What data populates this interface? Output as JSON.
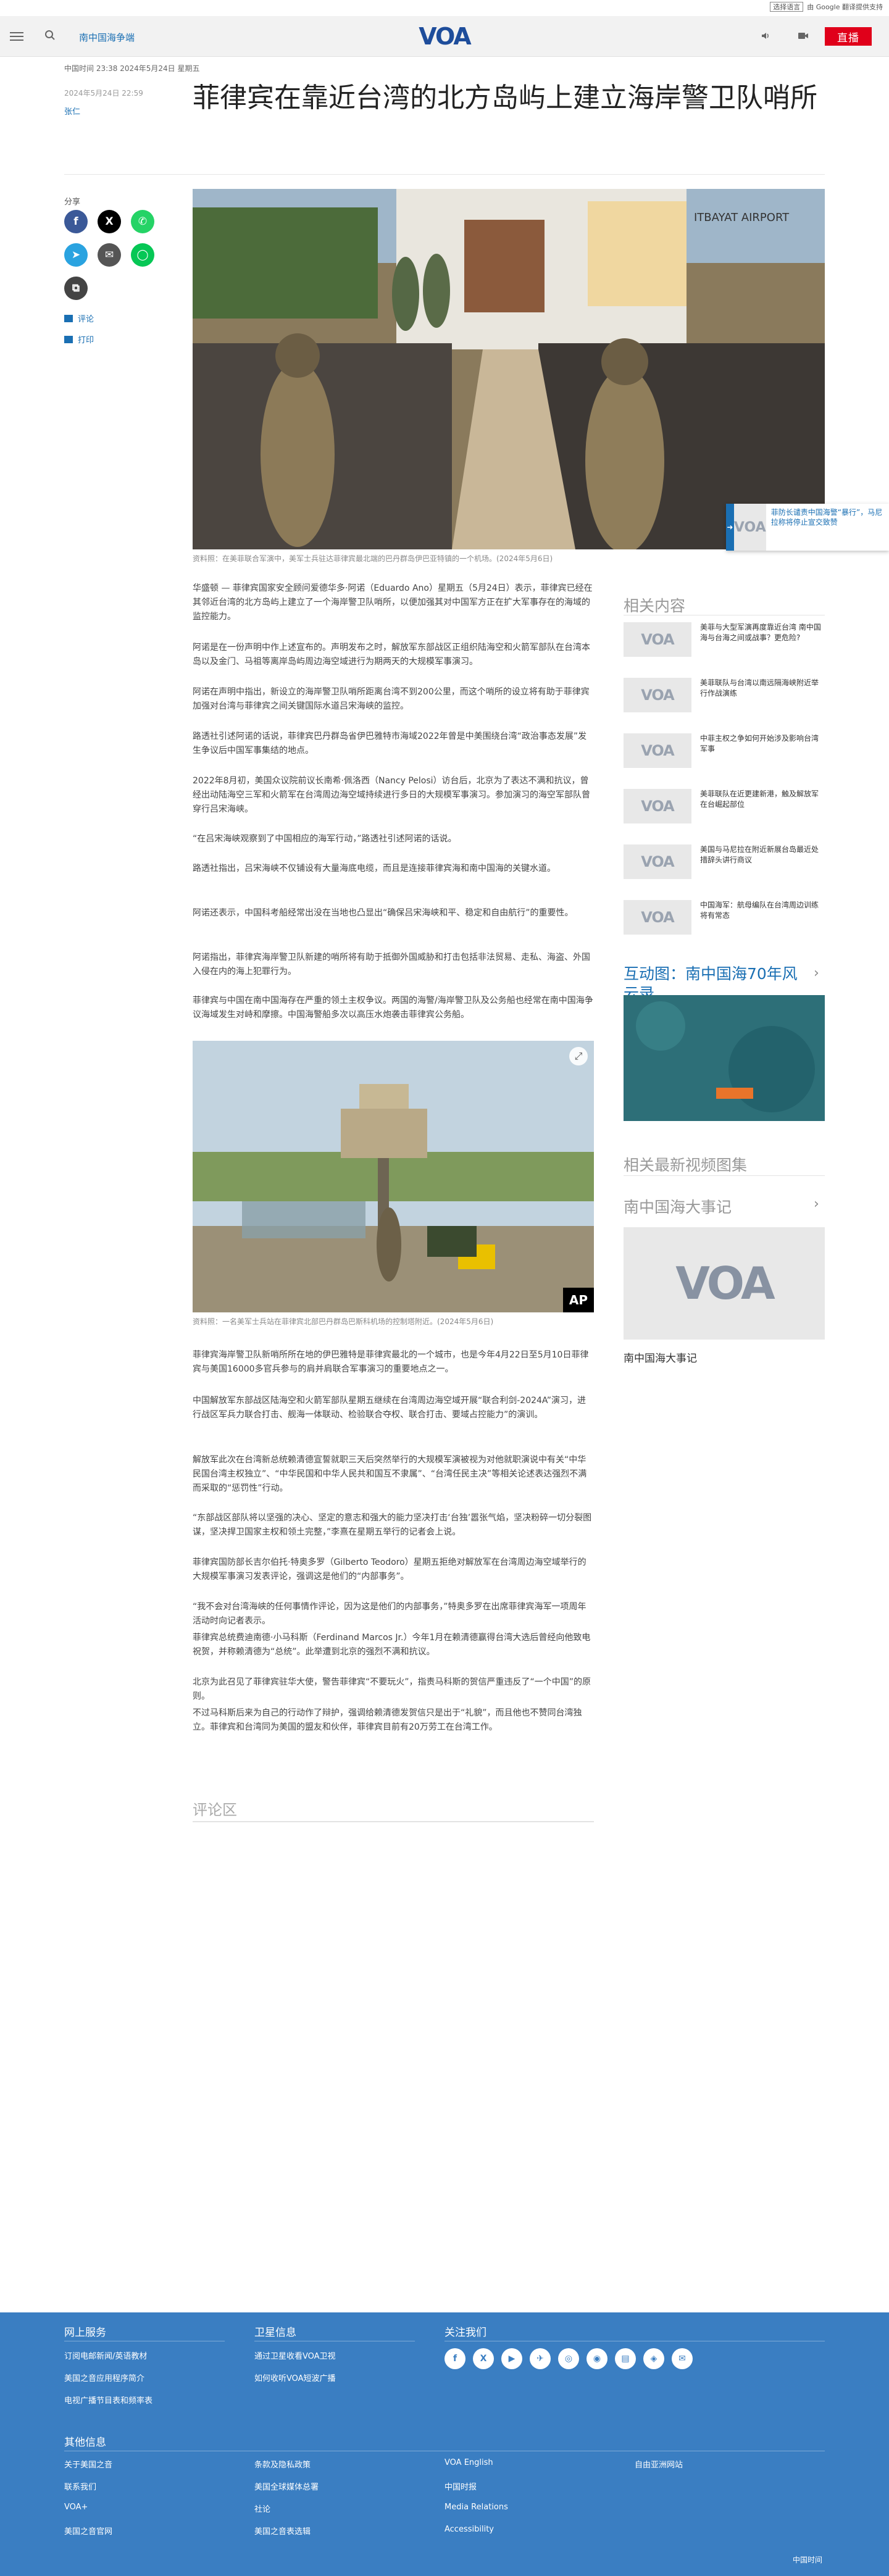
{
  "util": {
    "language_select": "选择语言",
    "powered": "由 Google 翻译提供支持"
  },
  "header": {
    "section_link": "南中国海争端",
    "logo": "VOA",
    "live_label": "直播"
  },
  "meta": {
    "top_line": "中国时间 23:38 2024年5月24日 星期五",
    "date": "2024年5月24日 22:59",
    "author": "张仁"
  },
  "title": "菲律宾在靠近台湾的北方岛屿上建立海岸警卫队哨所",
  "share": {
    "label": "分享",
    "comment_label": "评论",
    "print_label": "打印"
  },
  "hero": {
    "sign_text": "ITBAYAT AIRPORT",
    "caption": "资料照：在美菲联合军演中，美军士兵驻达菲律宾最北端的巴丹群岛伊巴亚特镇的一个机场。(2024年5月6日)"
  },
  "article": {
    "paragraphs": [
      "华盛顿 — 菲律宾国家安全顾问爱德华多·阿诺（Eduardo Ano）星期五（5月24日）表示，菲律宾已经在其邻近台湾的北方岛屿上建立了一个海岸警卫队哨所，以便加强其对中国军方正在扩大军事存在的海域的监控能力。",
      "阿诺是在一份声明中作上述宣布的。声明发布之时，解放军东部战区正组织陆海空和火箭军部队在台湾本岛以及金门、马祖等离岸岛屿周边海空域进行为期两天的大规模军事演习。",
      "阿诺在声明中指出，新设立的海岸警卫队哨所距离台湾不到200公里，而这个哨所的设立将有助于菲律宾加强对台湾与菲律宾之间关键国际水道吕宋海峡的监控。",
      "路透社引述阿诺的话说，菲律宾巴丹群岛省伊巴雅特市海域2022年曾是中美围绕台湾“政治事态发展”发生争议后中国军事集结的地点。",
      "2022年8月初，美国众议院前议长南希·佩洛西（Nancy Pelosi）访台后，北京为了表达不满和抗议，曾经出动陆海空三军和火箭军在台湾周边海空域持续进行多日的大规模军事演习。参加演习的海空军部队曾穿行吕宋海峡。",
      "“在吕宋海峡观察到了中国相应的海军行动，”路透社引述阿诺的话说。",
      "路透社指出，吕宋海峡不仅铺设有大量海底电缆，而且是连接菲律宾海和南中国海的关键水道。",
      "阿诺还表示，中国科考船经常出没在当地也凸显出“确保吕宋海峡和平、稳定和自由航行”的重要性。",
      "阿诺指出，菲律宾海岸警卫队新建的哨所将有助于抵御外国威胁和打击包括非法贸易、走私、海盗、外国入侵在内的海上犯罪行为。",
      "菲律宾与中国在南中国海存在严重的领土主权争议。两国的海警/海岸警卫队及公务船也经常在南中国海争议海域发生对峙和摩擦。中国海警船多次以高压水炮袭击菲律宾公务船。"
    ],
    "image2_caption": "资料照：一名美军士兵站在菲律宾北部巴丹群岛巴斯科机场的控制塔附近。(2024年5月6日)",
    "image2_badge": "AP",
    "paragraphs2": [
      "菲律宾海岸警卫队新哨所所在地的伊巴雅特是菲律宾最北的一个城市，也是今年4月22日至5月10日菲律宾与美国16000多官兵参与的肩并肩联合军事演习的重要地点之一。",
      "中国解放军东部战区陆海空和火箭军部队星期五继续在台湾周边海空域开展“联合利剑-2024A”演习，进行战区军兵力联合打击、舰海一体联动、检验联合夺权、联合打击、要域占控能力”的演训。",
      "解放军此次在台湾新总统赖清德宣誓就职三天后突然举行的大规模军演被视为对他就职演说中有关“中华民国台湾主权独立”、“中华民国和中华人民共和国互不隶属”、“台湾任民主决”等相关论述表达强烈不满而采取的“惩罚性”行动。",
      "“东部战区部队将以坚强的决心、坚定的意志和强大的能力坚决打击‘台独’嚣张气焰，坚决粉碎一切分裂图谋，坚决捍卫国家主权和领土完整，”李熹在星期五举行的记者会上说。",
      "菲律宾国防部长吉尔伯托·特奥多罗（Gilberto Teodoro）星期五拒绝对解放军在台湾周边海空域举行的大规模军事演习发表评论，强调这是他们的“内部事务”。",
      "“我不会对台湾海峡的任何事情作评论，因为这是他们的内部事务，”特奥多罗在出席菲律宾海军一项周年活动时向记者表示。",
      "菲律宾总统费迪南德·小马科斯（Ferdinand Marcos Jr.）今年1月在赖清德赢得台湾大选后曾经向他致电祝贺，并称赖清德为“总统”。此举遭到北京的强烈不满和抗议。",
      "北京为此召见了菲律宾驻华大使，警告菲律宾“不要玩火”，指责马科斯的贺信严重违反了“一个中国”的原则。",
      "不过马科斯后来为自己的行动作了辩护，强调给赖清德发贺信只是出于“礼貌”，而且他也不赞同台湾独立。菲律宾和台湾同为美国的盟友和伙伴，菲律宾目前有20万劳工在台湾工作。"
    ],
    "comments_head": "评论区"
  },
  "floating": {
    "text": "菲防长谴责中国海警“暴行”，马尼拉称将停止宣交致赞"
  },
  "sidebar": {
    "related_head": "相关内容",
    "related": [
      "美菲与大型军演再度靠近台湾 南中国海与台海之间或战事？更危险?",
      "美菲联队与台湾以南远隔海峡附近举行作战演练",
      "中菲主权之争如何开始涉及影响台湾军事",
      "美菲联队在近更建新港，触及解放军在台崛起部位",
      "美国与马尼拉在附近新展台岛最近处措辞头讲行商议",
      "中国海军：航母编队在台湾周边训练将有常态"
    ],
    "gallery_head": "互动图：南中国海70年风云录",
    "video_head": "相关最新视频图集",
    "timeline_head": "南中国海大事记",
    "timeline_caption": "南中国海大事记"
  },
  "footer": {
    "col1_head": "网上服务",
    "col1_links": [
      "订阅电邮新闻/英语教材",
      "美国之音应用程序简介",
      "电视广播节目表和频率表"
    ],
    "col2_head": "卫星信息",
    "col2_links": [
      "通过卫星收看VOA卫视",
      "如何收听VOA短波广播"
    ],
    "col3_head": "关注我们",
    "social": [
      "f",
      "X",
      "▶",
      "✈",
      "◎",
      "◉",
      "▤",
      "◈",
      "✉"
    ],
    "other_head": "其他信息",
    "other_links": [
      [
        "关于美国之音",
        "条款及隐私政策",
        "VOA English",
        "自由亚洲网站"
      ],
      [
        "联系我们",
        "美国全球媒体总署",
        "中国时报",
        ""
      ],
      [
        "VOA+",
        "社论",
        "Media Relations",
        ""
      ],
      [
        "美国之音官网",
        "美国之音表选辑",
        "Accessibility",
        ""
      ]
    ],
    "bottom_right": "中国时间"
  },
  "colors": {
    "accent": "#1a6fb3",
    "live": "#e0001a",
    "footer": "#3a7ec2",
    "logo": "#1e4d9b"
  }
}
